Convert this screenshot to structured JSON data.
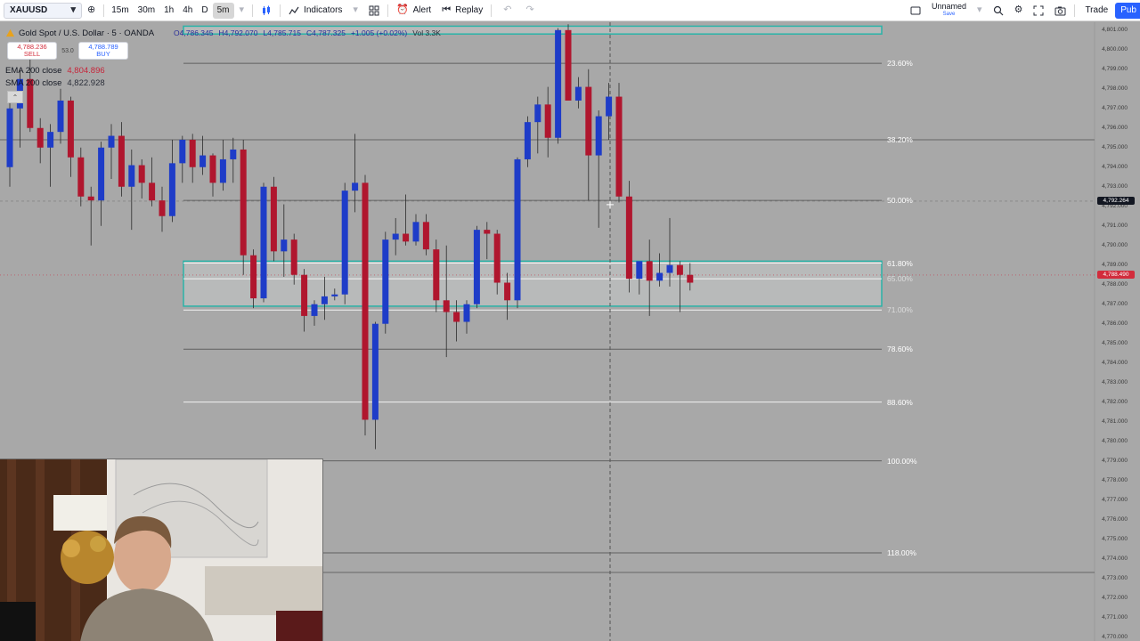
{
  "toolbar": {
    "symbol": "XAUUSD",
    "timeframes": [
      {
        "label": "15m",
        "active": false
      },
      {
        "label": "30m",
        "active": false
      },
      {
        "label": "1h",
        "active": false
      },
      {
        "label": "4h",
        "active": false
      },
      {
        "label": "D",
        "active": false
      },
      {
        "label": "5m",
        "active": true
      }
    ],
    "indicators_label": "Indicators",
    "alert_label": "Alert",
    "replay_label": "Replay",
    "layout_name": "Unnamed",
    "layout_status": "Save",
    "trade_label": "Trade",
    "publish_label": "Pub"
  },
  "legend": {
    "title": "Gold Spot / U.S. Dollar · 5 · OANDA",
    "open": "O4,786.345",
    "high": "H4,792.070",
    "low": "L4,785.715",
    "close": "C4,787.325",
    "change": "+1.005 (+0.02%)",
    "volume": "Vol 3.3K",
    "sell_price": "4,788.236",
    "sell_label": "SELL",
    "spread": "53.0",
    "buy_price": "4,788.789",
    "buy_label": "BUY",
    "ema_label": "EMA 200 close",
    "ema_value": "4,804.896",
    "sma_label": "SMA 200 close",
    "sma_value": "4,822.928"
  },
  "colors": {
    "background": "#a8a8a8",
    "up_candle": "#1e3cc8",
    "down_candle": "#b0162e",
    "zone_border": "#2bb3a8",
    "zone_fill": "#c4c8c8",
    "fib_line_dark": "#555555",
    "fib_line_light": "#ffffff",
    "price_badge_red": "#d22c3c",
    "crosshair_badge": "#131722"
  },
  "fib_levels": [
    {
      "label": "23.60%",
      "price": 4799.3,
      "style": "dark"
    },
    {
      "label": "38.20%",
      "price": 4795.4,
      "style": "dark"
    },
    {
      "label": "50.00%",
      "price": 4792.3,
      "style": "dark"
    },
    {
      "label": "61.80%",
      "price": 4789.1,
      "style": "light"
    },
    {
      "label": "65.00%",
      "price": 4788.3,
      "style": "light"
    },
    {
      "label": "71.00%",
      "price": 4786.7,
      "style": "light"
    },
    {
      "label": "78.60%",
      "price": 4784.7,
      "style": "dark"
    },
    {
      "label": "88.60%",
      "price": 4782.0,
      "style": "light"
    },
    {
      "label": "100.00%",
      "price": 4779.0,
      "style": "dark"
    },
    {
      "label": "118.00%",
      "price": 4774.3,
      "style": "dark"
    }
  ],
  "price_axis": {
    "ticks": [
      "4,801.000",
      "4,800.000",
      "4,799.000",
      "4,798.000",
      "4,797.000",
      "4,796.000",
      "4,795.000",
      "4,794.000",
      "4,793.000",
      "4,792.000",
      "4,791.000",
      "4,790.000",
      "4,789.000",
      "4,788.000",
      "4,787.000",
      "4,786.000",
      "4,785.000",
      "4,784.000",
      "4,783.000",
      "4,782.000",
      "4,781.000",
      "4,780.000",
      "4,779.000",
      "4,778.000",
      "4,777.000",
      "4,776.000",
      "4,775.000",
      "4,774.000",
      "4,773.000",
      "4,772.000",
      "4,771.000",
      "4,770.000"
    ],
    "crosshair_price": "4,792.264",
    "crosshair_price_value": 4792.264,
    "last_price": "4,788.490",
    "last_price_value": 4788.49
  },
  "chart_data": {
    "type": "candlestick",
    "ylim": [
      4769.8,
      4801.4
    ],
    "zones": [
      {
        "from": 4801.2,
        "to": 4800.8
      },
      {
        "from": 4786.9,
        "to": 4789.2
      }
    ],
    "candles": [
      {
        "o": 4794,
        "h": 4797.5,
        "l": 4793,
        "c": 4797
      },
      {
        "o": 4797,
        "h": 4799,
        "l": 4795,
        "c": 4798.5
      },
      {
        "o": 4798.5,
        "h": 4800.5,
        "l": 4795.8,
        "c": 4796
      },
      {
        "o": 4796,
        "h": 4796.5,
        "l": 4794.2,
        "c": 4795
      },
      {
        "o": 4795,
        "h": 4796.2,
        "l": 4793,
        "c": 4795.8
      },
      {
        "o": 4795.8,
        "h": 4798,
        "l": 4795.2,
        "c": 4797.4
      },
      {
        "o": 4797.4,
        "h": 4797.6,
        "l": 4793.5,
        "c": 4794.5
      },
      {
        "o": 4794.5,
        "h": 4795,
        "l": 4792,
        "c": 4792.5
      },
      {
        "o": 4792.5,
        "h": 4793,
        "l": 4790,
        "c": 4792.3
      },
      {
        "o": 4792.3,
        "h": 4795.3,
        "l": 4791,
        "c": 4795
      },
      {
        "o": 4795,
        "h": 4796.2,
        "l": 4793.4,
        "c": 4795.6
      },
      {
        "o": 4795.6,
        "h": 4796.3,
        "l": 4792.5,
        "c": 4793
      },
      {
        "o": 4793,
        "h": 4794.9,
        "l": 4790.8,
        "c": 4794.1
      },
      {
        "o": 4794.1,
        "h": 4794.4,
        "l": 4792.4,
        "c": 4793.2
      },
      {
        "o": 4793.2,
        "h": 4794.5,
        "l": 4792,
        "c": 4792.3
      },
      {
        "o": 4792.3,
        "h": 4793,
        "l": 4790.7,
        "c": 4791.5
      },
      {
        "o": 4791.5,
        "h": 4795.4,
        "l": 4791.2,
        "c": 4794.2
      },
      {
        "o": 4794.2,
        "h": 4795.6,
        "l": 4793.2,
        "c": 4795.4
      },
      {
        "o": 4795.4,
        "h": 4795.7,
        "l": 4793.2,
        "c": 4794
      },
      {
        "o": 4794,
        "h": 4795.6,
        "l": 4793.6,
        "c": 4794.6
      },
      {
        "o": 4794.6,
        "h": 4794.7,
        "l": 4792.5,
        "c": 4793.2
      },
      {
        "o": 4793.2,
        "h": 4795.4,
        "l": 4792.8,
        "c": 4794.4
      },
      {
        "o": 4794.4,
        "h": 4795.5,
        "l": 4793.2,
        "c": 4794.9
      },
      {
        "o": 4794.9,
        "h": 4795.4,
        "l": 4788.5,
        "c": 4789.5
      },
      {
        "o": 4789.5,
        "h": 4789.8,
        "l": 4786.8,
        "c": 4787.3
      },
      {
        "o": 4787.3,
        "h": 4793.2,
        "l": 4787.1,
        "c": 4793
      },
      {
        "o": 4793,
        "h": 4793.5,
        "l": 4789.2,
        "c": 4789.7
      },
      {
        "o": 4789.7,
        "h": 4792.1,
        "l": 4788.4,
        "c": 4790.3
      },
      {
        "o": 4790.3,
        "h": 4790.6,
        "l": 4788,
        "c": 4788.5
      },
      {
        "o": 4788.5,
        "h": 4788.8,
        "l": 4785.6,
        "c": 4786.4
      },
      {
        "o": 4786.4,
        "h": 4787.2,
        "l": 4785.9,
        "c": 4787
      },
      {
        "o": 4787,
        "h": 4788.4,
        "l": 4786.2,
        "c": 4787.4
      },
      {
        "o": 4787.4,
        "h": 4787.8,
        "l": 4787.2,
        "c": 4787.5
      },
      {
        "o": 4787.5,
        "h": 4793.2,
        "l": 4787,
        "c": 4792.8
      },
      {
        "o": 4792.8,
        "h": 4795.7,
        "l": 4791.7,
        "c": 4793.2
      },
      {
        "o": 4793.2,
        "h": 4793.6,
        "l": 4780.3,
        "c": 4781.1
      },
      {
        "o": 4781.1,
        "h": 4786.1,
        "l": 4779.6,
        "c": 4786
      },
      {
        "o": 4786,
        "h": 4790.7,
        "l": 4785.5,
        "c": 4790.3
      },
      {
        "o": 4790.3,
        "h": 4791.4,
        "l": 4789.5,
        "c": 4790.6
      },
      {
        "o": 4790.6,
        "h": 4792.6,
        "l": 4790,
        "c": 4790.2
      },
      {
        "o": 4790.2,
        "h": 4791.6,
        "l": 4790,
        "c": 4791.2
      },
      {
        "o": 4791.2,
        "h": 4791.6,
        "l": 4789.5,
        "c": 4789.8
      },
      {
        "o": 4789.8,
        "h": 4790.3,
        "l": 4786.6,
        "c": 4787.2
      },
      {
        "o": 4787.2,
        "h": 4790,
        "l": 4784.3,
        "c": 4786.6
      },
      {
        "o": 4786.6,
        "h": 4787.2,
        "l": 4785.1,
        "c": 4786.1
      },
      {
        "o": 4786.1,
        "h": 4787.2,
        "l": 4785.5,
        "c": 4787.0
      },
      {
        "o": 4787.0,
        "h": 4791.0,
        "l": 4786.8,
        "c": 4790.8
      },
      {
        "o": 4790.8,
        "h": 4791.2,
        "l": 4789.3,
        "c": 4790.6
      },
      {
        "o": 4790.6,
        "h": 4790.8,
        "l": 4787.5,
        "c": 4788.1
      },
      {
        "o": 4788.1,
        "h": 4788.6,
        "l": 4786.2,
        "c": 4787.2
      },
      {
        "o": 4787.2,
        "h": 4794.5,
        "l": 4786.8,
        "c": 4794.4
      },
      {
        "o": 4794.4,
        "h": 4796.6,
        "l": 4794,
        "c": 4796.3
      },
      {
        "o": 4796.3,
        "h": 4797.6,
        "l": 4794.7,
        "c": 4797.2
      },
      {
        "o": 4797.2,
        "h": 4798.1,
        "l": 4794.5,
        "c": 4795.5
      },
      {
        "o": 4795.5,
        "h": 4801.1,
        "l": 4795.2,
        "c": 4801.0
      },
      {
        "o": 4801.0,
        "h": 4801.3,
        "l": 4797.8,
        "c": 4797.4
      },
      {
        "o": 4797.4,
        "h": 4798.6,
        "l": 4797,
        "c": 4798.1
      },
      {
        "o": 4798.1,
        "h": 4799,
        "l": 4792.3,
        "c": 4794.6
      },
      {
        "o": 4794.6,
        "h": 4796.9,
        "l": 4790.9,
        "c": 4796.6
      },
      {
        "o": 4796.6,
        "h": 4798.3,
        "l": 4795.4,
        "c": 4797.6
      },
      {
        "o": 4797.6,
        "h": 4798.3,
        "l": 4792.2,
        "c": 4792.5
      },
      {
        "o": 4792.5,
        "h": 4793.3,
        "l": 4787.6,
        "c": 4788.3
      },
      {
        "o": 4788.3,
        "h": 4788.9,
        "l": 4787.5,
        "c": 4789.2
      },
      {
        "o": 4789.2,
        "h": 4790.3,
        "l": 4786.4,
        "c": 4788.2
      },
      {
        "o": 4788.2,
        "h": 4789.6,
        "l": 4787.9,
        "c": 4788.6
      },
      {
        "o": 4788.6,
        "h": 4791.4,
        "l": 4787.9,
        "c": 4789.0
      },
      {
        "o": 4789.0,
        "h": 4789.2,
        "l": 4786.6,
        "c": 4788.5
      },
      {
        "o": 4788.5,
        "h": 4789.1,
        "l": 4787.7,
        "c": 4788.1
      }
    ]
  }
}
